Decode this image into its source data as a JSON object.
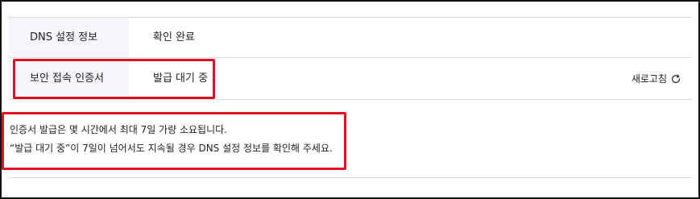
{
  "dns_row": {
    "label": "DNS 설정 정보",
    "value": "확인 완료"
  },
  "ssl_row": {
    "label": "보안 접속 인증서",
    "value": "발급 대기 중",
    "refresh_label": "새로고침",
    "refresh_icon": "refresh-icon"
  },
  "notice": {
    "line1": "인증서 발급은 몇 시간에서 최대 7일 가량 소요됩니다.",
    "line2": "“발급 대기 중”이 7일이 넘어서도 지속될 경우 DNS 설정 정보를 확인해 주세요."
  },
  "colors": {
    "highlight": "#e0111f",
    "label_bg": "#f4f6fa",
    "divider": "#dddddd"
  }
}
